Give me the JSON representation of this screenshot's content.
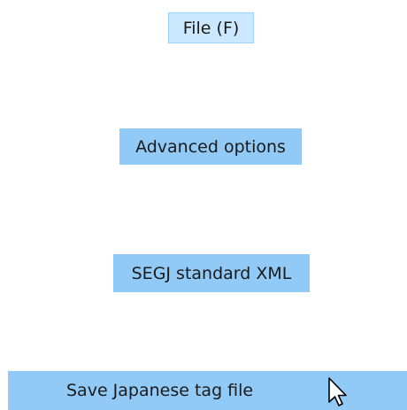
{
  "menu": {
    "file_label": "File (F)",
    "advanced_options_label": "Advanced options",
    "segj_label": "SEGJ standard XML",
    "save_tag_label": "Save Japanese tag file"
  },
  "colors": {
    "menu_bar_highlight": "#cce8ff",
    "menu_item_highlight": "#91c9f7"
  },
  "icons": {
    "cursor": "mouse-pointer-icon"
  }
}
